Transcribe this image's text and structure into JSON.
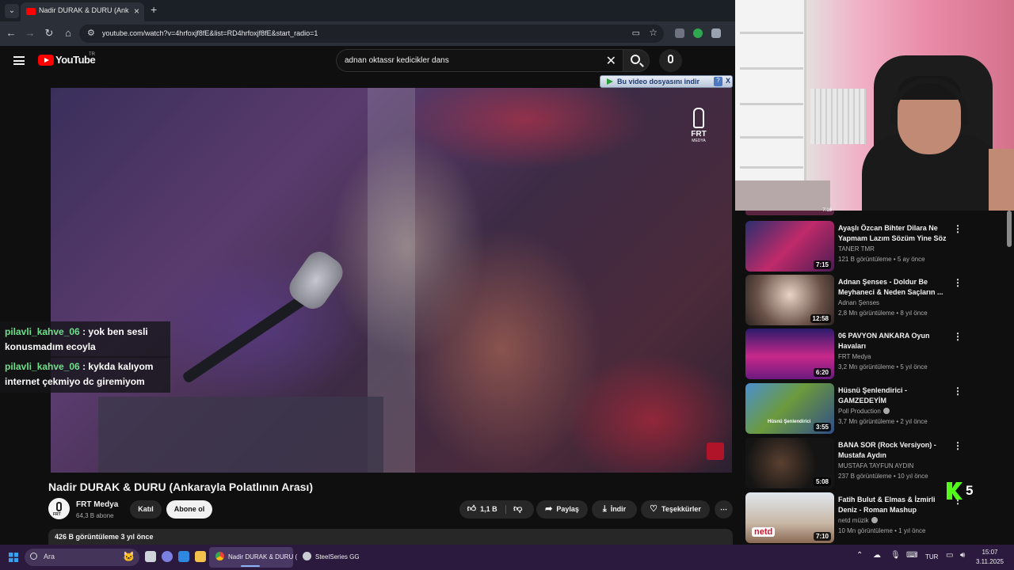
{
  "browser": {
    "tab_title": "Nadir DURAK & DURU (Ank",
    "url": "youtube.com/watch?v=4hrfoxjf8fE&list=RD4hrfoxjf8fE&start_radio=1"
  },
  "youtube": {
    "logo_text": "YouTube",
    "country": "TR",
    "search_query": "adnan oktassr kedicikler dans",
    "download_extension_label": "Bu video dosyasını indir",
    "download_help": "?",
    "download_close": "X"
  },
  "video": {
    "title": "Nadir DURAK & DURU (Ankarayla Polatlının Arası)",
    "watermark": "FRT",
    "watermark_sub": "MEDYA",
    "channel_name": "FRT Medya",
    "subscribers": "64,3 B abone",
    "join_label": "Katıl",
    "subscribe_label": "Abone ol",
    "likes": "1,1 B",
    "share_label": "Paylaş",
    "download_label": "İndir",
    "thanks_label": "Teşekkürler",
    "views_line": "426 B görüntüleme  3 yıl önce"
  },
  "chat": [
    {
      "user": "pilavli_kahve_06",
      "message": " : yok ben sesli",
      "message2": "konusmadım ecoyla"
    },
    {
      "user": "pilavli_kahve_06",
      "message": " : kykda kalıyom",
      "message2": "internet çekmiyo dc giremiyom"
    }
  ],
  "sidebar": {
    "items": [
      {
        "title": "Ayaşlı Özcan Bihter Dilara Ne Yapmam Lazım Sözüm Yine Söz",
        "channel": "TANER TMR",
        "meta": "121 B görüntüleme • 5 ay önce",
        "duration": "7:15",
        "verified": false
      },
      {
        "title": "Adnan Şenses - Doldur Be Meyhaneci & Neden Saçların ...",
        "channel": "Adnan Şenses",
        "meta": "2,8 Mn görüntüleme • 8 yıl önce",
        "duration": "12:58",
        "verified": false
      },
      {
        "title": "06 PAVYON ANKARA Oyun Havaları",
        "channel": "FRT Medya",
        "meta": "3,2 Mn görüntüleme • 5 yıl önce",
        "duration": "6:20",
        "verified": false
      },
      {
        "title": "Hüsnü Şenlendirici - GAMZEDEYİM",
        "channel": "Poll Production",
        "meta": "3,7 Mn görüntüleme • 2 yıl önce",
        "duration": "3:55",
        "verified": true
      },
      {
        "title": "BANA SOR (Rock Versiyon) - Mustafa Aydın",
        "channel": "MUSTAFA TAYFUN AYDIN",
        "meta": "237 B görüntüleme • 10 yıl önce",
        "duration": "5:08",
        "verified": false
      },
      {
        "title": "Fatih Bulut & Elmas & İzmirli Deniz - Roman Mashup",
        "channel": "netd müzik",
        "meta": "10 Mn görüntüleme • 1 yıl önce",
        "duration": "7:10",
        "verified": true
      }
    ],
    "top_partial_duration": "7:16",
    "thumb_text_4": "Hüsnü Şenlendirici",
    "thumb_text_6": "netd"
  },
  "overlay": {
    "kick_count": "5"
  },
  "taskbar": {
    "search_placeholder": "Ara",
    "chrome_app": "Nadir DURAK & DURU (",
    "steel_app": "SteelSeries GG",
    "language": "TUR",
    "time": "15:07",
    "date": "3.11.2025"
  },
  "colors": {
    "yt_red": "#ff0000",
    "kick_green": "#53fc18",
    "chat_user": "#6fe08a"
  }
}
